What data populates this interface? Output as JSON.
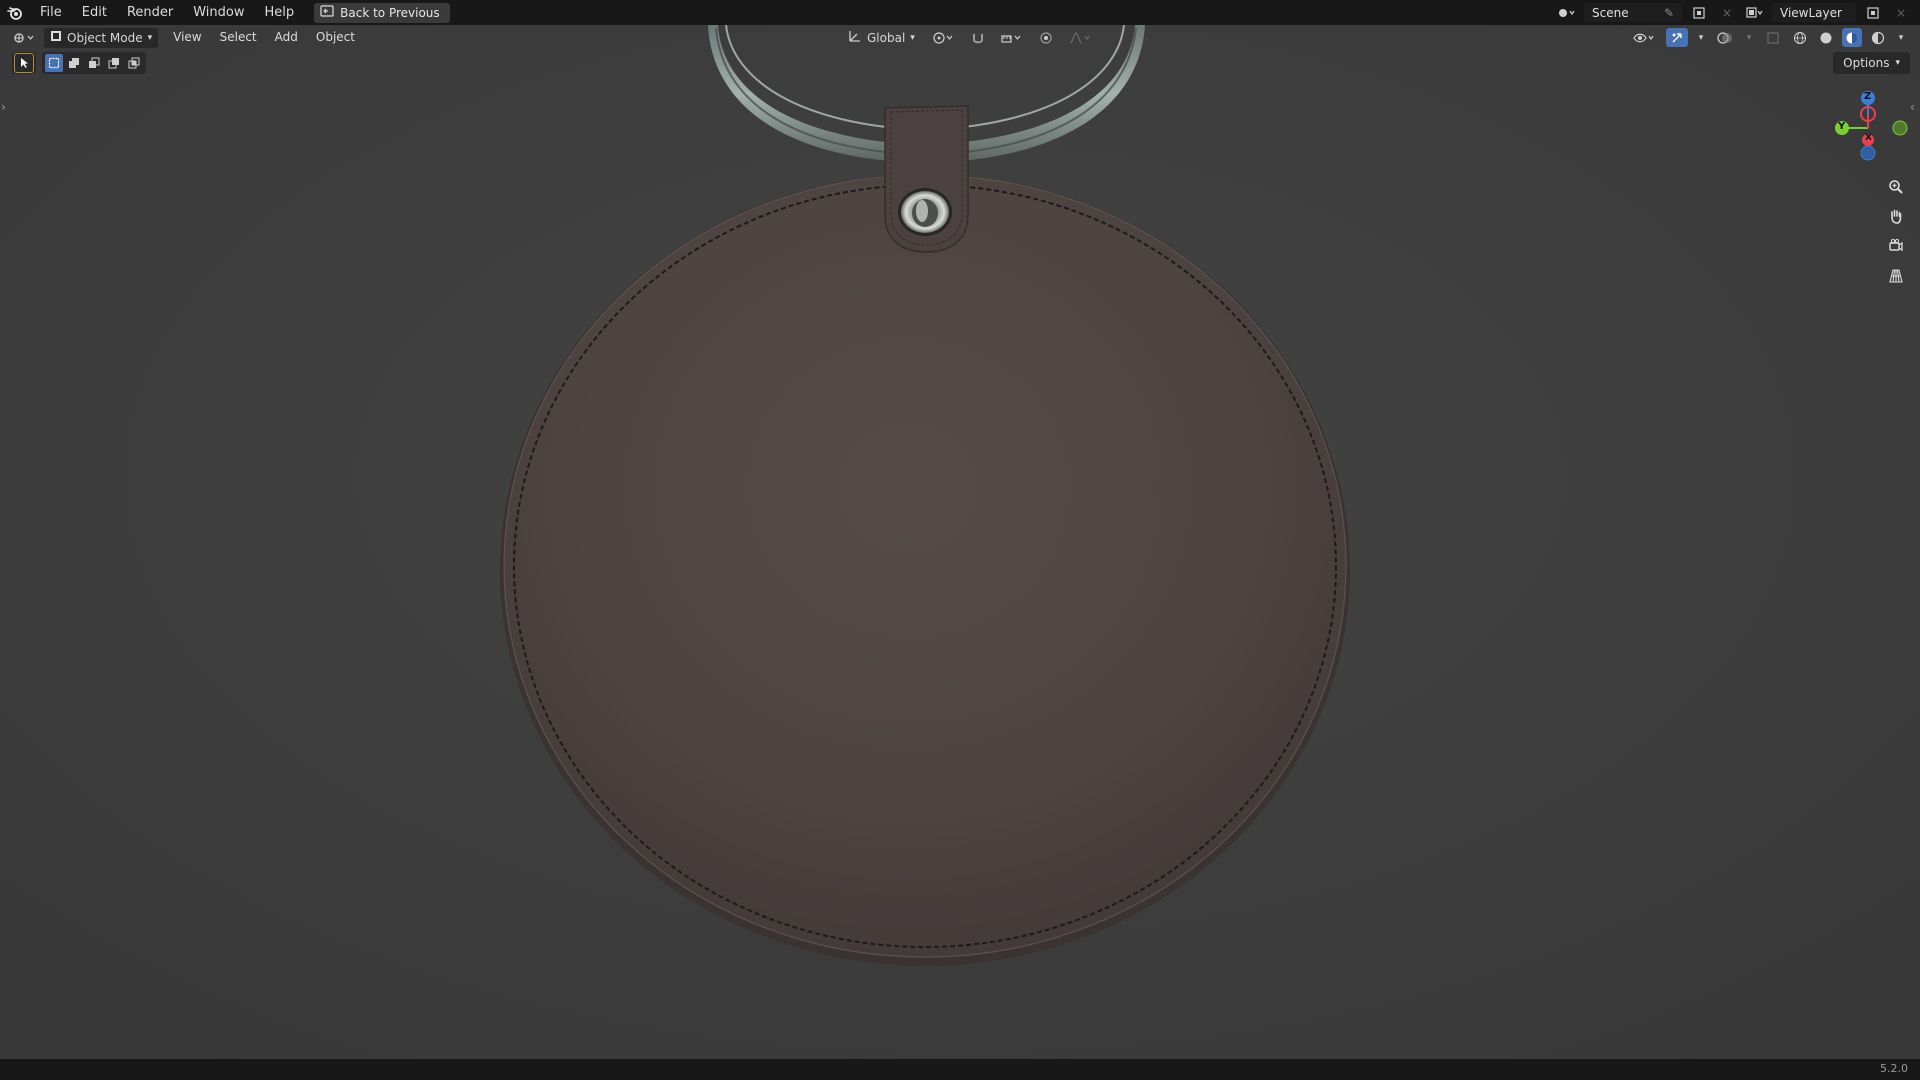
{
  "topbar": {
    "menus": [
      "File",
      "Edit",
      "Render",
      "Window",
      "Help"
    ],
    "back_label": "Back to Previous",
    "scene_label": "Scene",
    "viewlayer_label": "ViewLayer"
  },
  "viewport_header": {
    "mode_label": "Object Mode",
    "menus": [
      "View",
      "Select",
      "Add",
      "Object"
    ],
    "orientation_label": "Global"
  },
  "options_label": "Options",
  "gizmo": {
    "z_label": "Z",
    "y_label": "Y",
    "x_label": "X"
  },
  "status": {
    "version": "5.2.0"
  },
  "colors": {
    "background": "#3d3d3d",
    "leather": "#4e4443",
    "accent": "#4772b3",
    "axis_x": "#e8404f",
    "axis_y": "#7bcf32",
    "axis_z": "#3b7fd8"
  }
}
